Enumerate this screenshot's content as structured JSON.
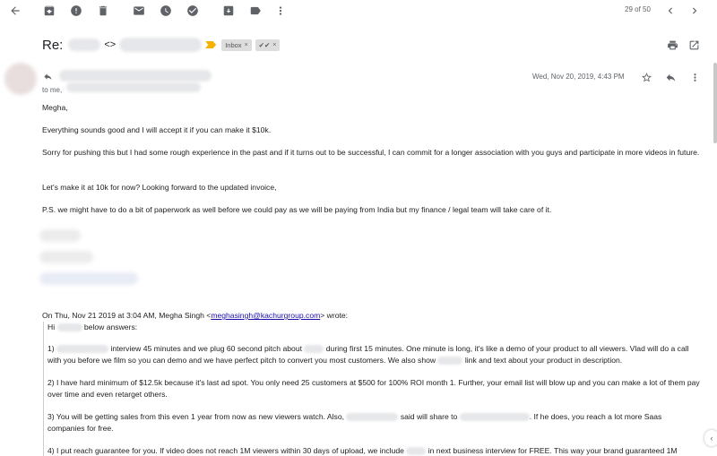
{
  "toolbar": {
    "icons": [
      "back-arrow-icon",
      "archive-icon",
      "report-spam-icon",
      "delete-icon",
      "mark-unread-icon",
      "snooze-icon",
      "add-to-tasks-icon",
      "move-to-icon",
      "labels-icon",
      "more-vert-icon"
    ],
    "pager_text": "29 of 50",
    "prev_icon": "chevron-left-icon",
    "next_icon": "chevron-right-icon"
  },
  "subject": {
    "prefix": "Re:",
    "middle": "<>",
    "labels": [
      {
        "text": "Inbox",
        "remove": "×"
      },
      {
        "text": "✔✔",
        "remove": "×"
      }
    ],
    "print_icon": "print-icon",
    "new_window_icon": "open-in-new-window-icon"
  },
  "message": {
    "to": "to me,",
    "date": "Wed, Nov 20, 2019, 4:43 PM",
    "star_icon": "star-icon",
    "reply_icon": "reply-icon",
    "more_icon": "more-vert-icon",
    "paragraphs": [
      "Megha,",
      "Everything sounds good and I will accept it if you can make it $10k.",
      "Sorry for pushing this but I had some rough experience in the past and if it turns out to be successful, I can commit for a longer association with you guys and participate in more videos in future.",
      "Let's make it at 10k for now? Looking forward to the updated invoice,",
      "P.S. we might have to do a bit of paperwork as well before we could pay as we will be paying from India but my finance / legal team will take care of it."
    ]
  },
  "quoted": {
    "header_prefix": "On Thu, Nov 21 2019 at 3:04 AM, Megha Singh <",
    "header_email": "meghasingh@kachurgroup.com",
    "header_suffix": "> wrote:",
    "greeting_a": "Hi",
    "greeting_b": "below answers:",
    "p1_a": "1)",
    "p1_b": "interview 45 minutes and we plug 60 second pitch about",
    "p1_c": "during first 15 minutes. One minute is long, it's like a demo of your product to all viewers. Vlad will do a call with you before we film so you can demo and we have perfect pitch to convert you most customers. We also show",
    "p1_d": "link and text about your product in description.",
    "p2": "2) I have hard minimum of $12.5k because it's last ad spot. You only need 25 customers at $500 for 100% ROI month 1. Further, your email list will blow up and you can make a lot of them pay over time and even retarget others.",
    "p3_a": "3) You will be getting sales from this even 1 year from now as new viewers watch. Also,",
    "p3_b": "said will share to",
    "p3_c": ". If he does, you reach a lot more Saas companies for free.",
    "p4_a": "4) I put reach guarantee for you. If video does not reach 1M viewers within 30 days of upload, we include",
    "p4_b": "in next business interview for FREE. This way your brand guaranteed 1M"
  },
  "colors": {
    "icon": "#5f6368",
    "link": "#1a0dab",
    "label_bg": "#dddddd",
    "importance": "#f5b301"
  }
}
